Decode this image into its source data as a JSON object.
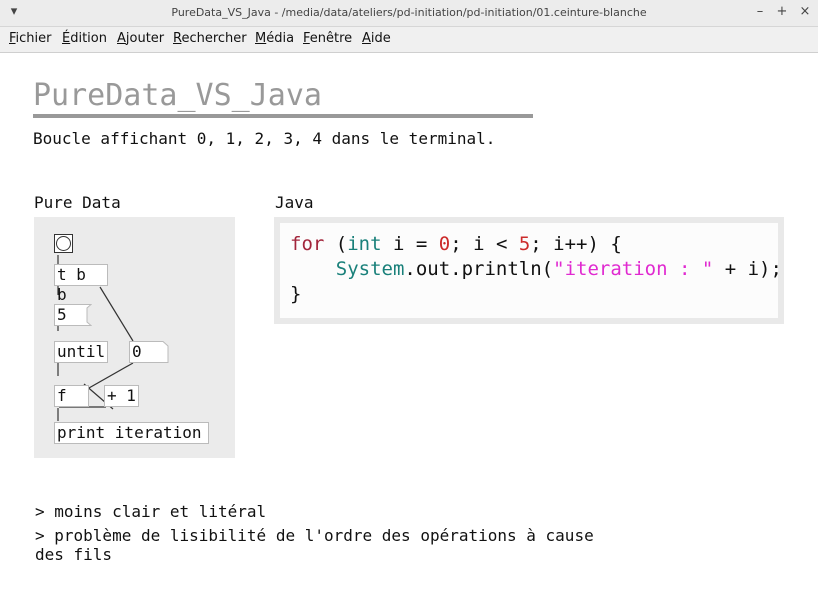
{
  "window": {
    "title": "PureData_VS_Java  - /media/data/ateliers/pd-initiation/pd-initiation/01.ceinture-blanche",
    "menu_icon": "chevron-down-icon",
    "min_glyph": "–",
    "max_glyph": "+",
    "close_glyph": "×"
  },
  "menu": [
    "Fichier",
    "Édition",
    "Ajouter",
    "Rechercher",
    "Média",
    "Fenêtre",
    "Aide"
  ],
  "page": {
    "heading": "PureData_VS_Java",
    "subtitle": "Boucle affichant 0, 1, 2, 3, 4 dans le terminal.",
    "pd_label": "Pure Data",
    "java_label": "Java"
  },
  "pd": {
    "obj_tbb": "t b b",
    "num_5": "5",
    "obj_until": "until",
    "num_0": "0",
    "obj_f": "f",
    "obj_plus1": "+ 1",
    "obj_print": "print iteration"
  },
  "java": {
    "for": "for",
    "open": " (",
    "int": "int",
    "mid1": " i = ",
    "zero": "0",
    "mid2": "; i < ",
    "five": "5",
    "end1": "; i++) {",
    "indent": "    ",
    "system": "System",
    "println": ".out.println(",
    "str": "\"iteration : \"",
    "end2": " + i);",
    "close": "}"
  },
  "notes": {
    "line1": "> moins clair et litéral",
    "line2a": "> problème de lisibilité de l'ordre des opérations à cause",
    "line2b": "des fils"
  },
  "colors": {
    "keyword": "#a2253b",
    "type": "#19807a",
    "number": "#cc2b2b",
    "string": "#e02ad0",
    "heading": "#999999"
  }
}
